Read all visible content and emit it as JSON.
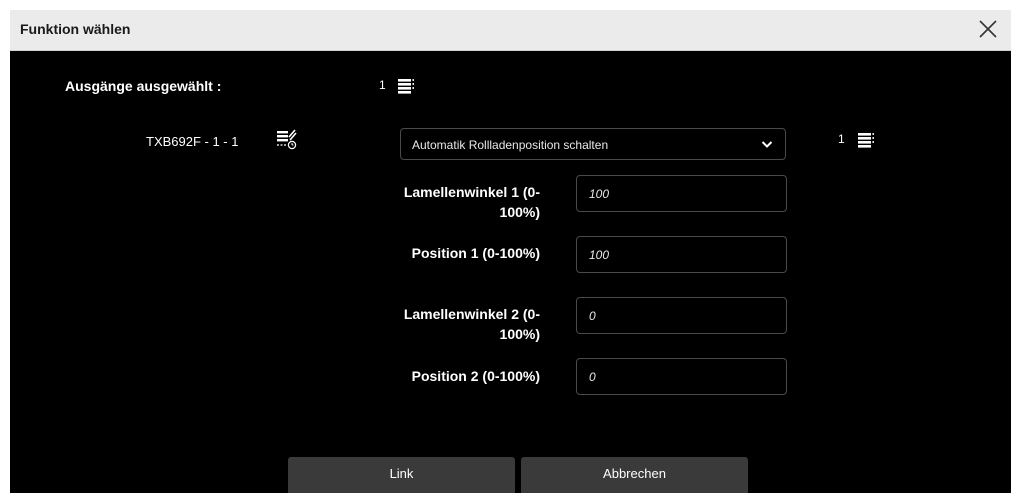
{
  "dialog": {
    "title": "Funktion wählen"
  },
  "outputs": {
    "label": "Ausgänge ausgewählt :",
    "count": "1",
    "icon": "blinds-stack-icon"
  },
  "device": {
    "name": "TXB692F - 1 - 1",
    "icon": "blinds-clock-icon",
    "function_selected": "Automatik Rollladenposition schalten",
    "right_count": "1"
  },
  "fields": [
    {
      "label": "Lamellenwinkel 1 (0-100%)",
      "value": "100"
    },
    {
      "label": "Position 1 (0-100%)",
      "value": "100"
    },
    {
      "label": "Lamellenwinkel 2 (0-100%)",
      "value": "0"
    },
    {
      "label": "Position 2 (0-100%)",
      "value": "0"
    }
  ],
  "buttons": {
    "link": "Link",
    "cancel": "Abbrechen"
  },
  "colors": {
    "background": "#000000",
    "titlebar": "#ebebeb",
    "button": "#3a3a3a",
    "input_border": "#4a4a4a"
  }
}
